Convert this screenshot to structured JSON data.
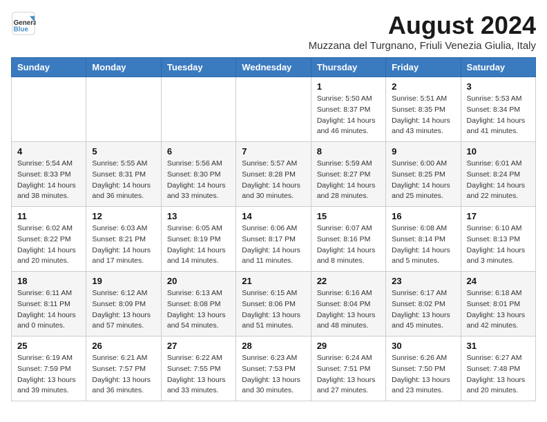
{
  "header": {
    "logo_text_general": "General",
    "logo_text_blue": "Blue",
    "month_title": "August 2024",
    "subtitle": "Muzzana del Turgnano, Friuli Venezia Giulia, Italy"
  },
  "days_of_week": [
    "Sunday",
    "Monday",
    "Tuesday",
    "Wednesday",
    "Thursday",
    "Friday",
    "Saturday"
  ],
  "weeks": [
    [
      {
        "day": "",
        "info": ""
      },
      {
        "day": "",
        "info": ""
      },
      {
        "day": "",
        "info": ""
      },
      {
        "day": "",
        "info": ""
      },
      {
        "day": "1",
        "info": "Sunrise: 5:50 AM\nSunset: 8:37 PM\nDaylight: 14 hours\nand 46 minutes."
      },
      {
        "day": "2",
        "info": "Sunrise: 5:51 AM\nSunset: 8:35 PM\nDaylight: 14 hours\nand 43 minutes."
      },
      {
        "day": "3",
        "info": "Sunrise: 5:53 AM\nSunset: 8:34 PM\nDaylight: 14 hours\nand 41 minutes."
      }
    ],
    [
      {
        "day": "4",
        "info": "Sunrise: 5:54 AM\nSunset: 8:33 PM\nDaylight: 14 hours\nand 38 minutes."
      },
      {
        "day": "5",
        "info": "Sunrise: 5:55 AM\nSunset: 8:31 PM\nDaylight: 14 hours\nand 36 minutes."
      },
      {
        "day": "6",
        "info": "Sunrise: 5:56 AM\nSunset: 8:30 PM\nDaylight: 14 hours\nand 33 minutes."
      },
      {
        "day": "7",
        "info": "Sunrise: 5:57 AM\nSunset: 8:28 PM\nDaylight: 14 hours\nand 30 minutes."
      },
      {
        "day": "8",
        "info": "Sunrise: 5:59 AM\nSunset: 8:27 PM\nDaylight: 14 hours\nand 28 minutes."
      },
      {
        "day": "9",
        "info": "Sunrise: 6:00 AM\nSunset: 8:25 PM\nDaylight: 14 hours\nand 25 minutes."
      },
      {
        "day": "10",
        "info": "Sunrise: 6:01 AM\nSunset: 8:24 PM\nDaylight: 14 hours\nand 22 minutes."
      }
    ],
    [
      {
        "day": "11",
        "info": "Sunrise: 6:02 AM\nSunset: 8:22 PM\nDaylight: 14 hours\nand 20 minutes."
      },
      {
        "day": "12",
        "info": "Sunrise: 6:03 AM\nSunset: 8:21 PM\nDaylight: 14 hours\nand 17 minutes."
      },
      {
        "day": "13",
        "info": "Sunrise: 6:05 AM\nSunset: 8:19 PM\nDaylight: 14 hours\nand 14 minutes."
      },
      {
        "day": "14",
        "info": "Sunrise: 6:06 AM\nSunset: 8:17 PM\nDaylight: 14 hours\nand 11 minutes."
      },
      {
        "day": "15",
        "info": "Sunrise: 6:07 AM\nSunset: 8:16 PM\nDaylight: 14 hours\nand 8 minutes."
      },
      {
        "day": "16",
        "info": "Sunrise: 6:08 AM\nSunset: 8:14 PM\nDaylight: 14 hours\nand 5 minutes."
      },
      {
        "day": "17",
        "info": "Sunrise: 6:10 AM\nSunset: 8:13 PM\nDaylight: 14 hours\nand 3 minutes."
      }
    ],
    [
      {
        "day": "18",
        "info": "Sunrise: 6:11 AM\nSunset: 8:11 PM\nDaylight: 14 hours\nand 0 minutes."
      },
      {
        "day": "19",
        "info": "Sunrise: 6:12 AM\nSunset: 8:09 PM\nDaylight: 13 hours\nand 57 minutes."
      },
      {
        "day": "20",
        "info": "Sunrise: 6:13 AM\nSunset: 8:08 PM\nDaylight: 13 hours\nand 54 minutes."
      },
      {
        "day": "21",
        "info": "Sunrise: 6:15 AM\nSunset: 8:06 PM\nDaylight: 13 hours\nand 51 minutes."
      },
      {
        "day": "22",
        "info": "Sunrise: 6:16 AM\nSunset: 8:04 PM\nDaylight: 13 hours\nand 48 minutes."
      },
      {
        "day": "23",
        "info": "Sunrise: 6:17 AM\nSunset: 8:02 PM\nDaylight: 13 hours\nand 45 minutes."
      },
      {
        "day": "24",
        "info": "Sunrise: 6:18 AM\nSunset: 8:01 PM\nDaylight: 13 hours\nand 42 minutes."
      }
    ],
    [
      {
        "day": "25",
        "info": "Sunrise: 6:19 AM\nSunset: 7:59 PM\nDaylight: 13 hours\nand 39 minutes."
      },
      {
        "day": "26",
        "info": "Sunrise: 6:21 AM\nSunset: 7:57 PM\nDaylight: 13 hours\nand 36 minutes."
      },
      {
        "day": "27",
        "info": "Sunrise: 6:22 AM\nSunset: 7:55 PM\nDaylight: 13 hours\nand 33 minutes."
      },
      {
        "day": "28",
        "info": "Sunrise: 6:23 AM\nSunset: 7:53 PM\nDaylight: 13 hours\nand 30 minutes."
      },
      {
        "day": "29",
        "info": "Sunrise: 6:24 AM\nSunset: 7:51 PM\nDaylight: 13 hours\nand 27 minutes."
      },
      {
        "day": "30",
        "info": "Sunrise: 6:26 AM\nSunset: 7:50 PM\nDaylight: 13 hours\nand 23 minutes."
      },
      {
        "day": "31",
        "info": "Sunrise: 6:27 AM\nSunset: 7:48 PM\nDaylight: 13 hours\nand 20 minutes."
      }
    ]
  ]
}
